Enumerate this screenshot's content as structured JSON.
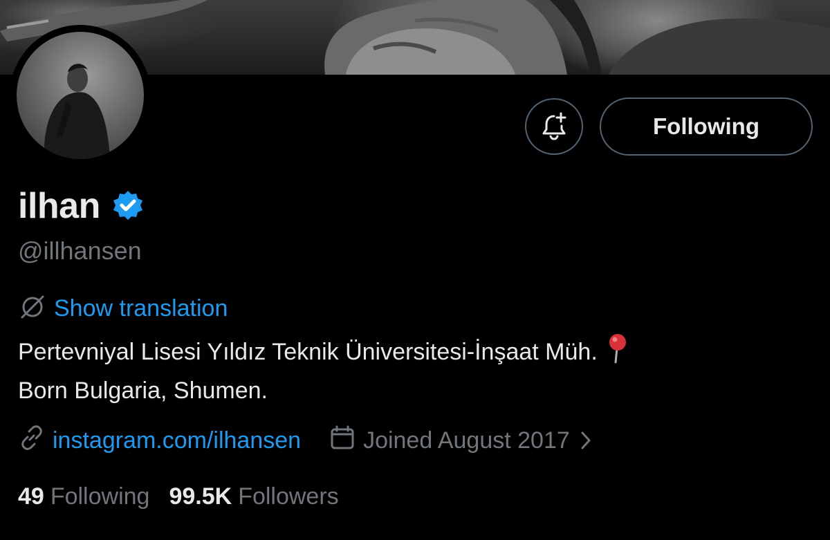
{
  "profile": {
    "display_name": "ilhan",
    "handle": "@illhansen",
    "verified": true,
    "bio_line1": "Pertevniyal Lisesi Yıldız Teknik Üniversitesi-İnşaat Müh.",
    "bio_line2": "Born Bulgaria, Shumen.",
    "website": "instagram.com/ilhansen",
    "joined": "Joined August 2017"
  },
  "actions": {
    "follow_label": "Following",
    "notify_icon": "bell-plus-icon"
  },
  "translation": {
    "label": "Show translation"
  },
  "stats": {
    "following_count": "49",
    "following_label": "Following",
    "followers_count": "99.5K",
    "followers_label": "Followers"
  },
  "colors": {
    "background": "#000000",
    "accent": "#1d9bf0",
    "muted": "#71767b",
    "text": "#e7e9ea",
    "border": "#536471"
  }
}
